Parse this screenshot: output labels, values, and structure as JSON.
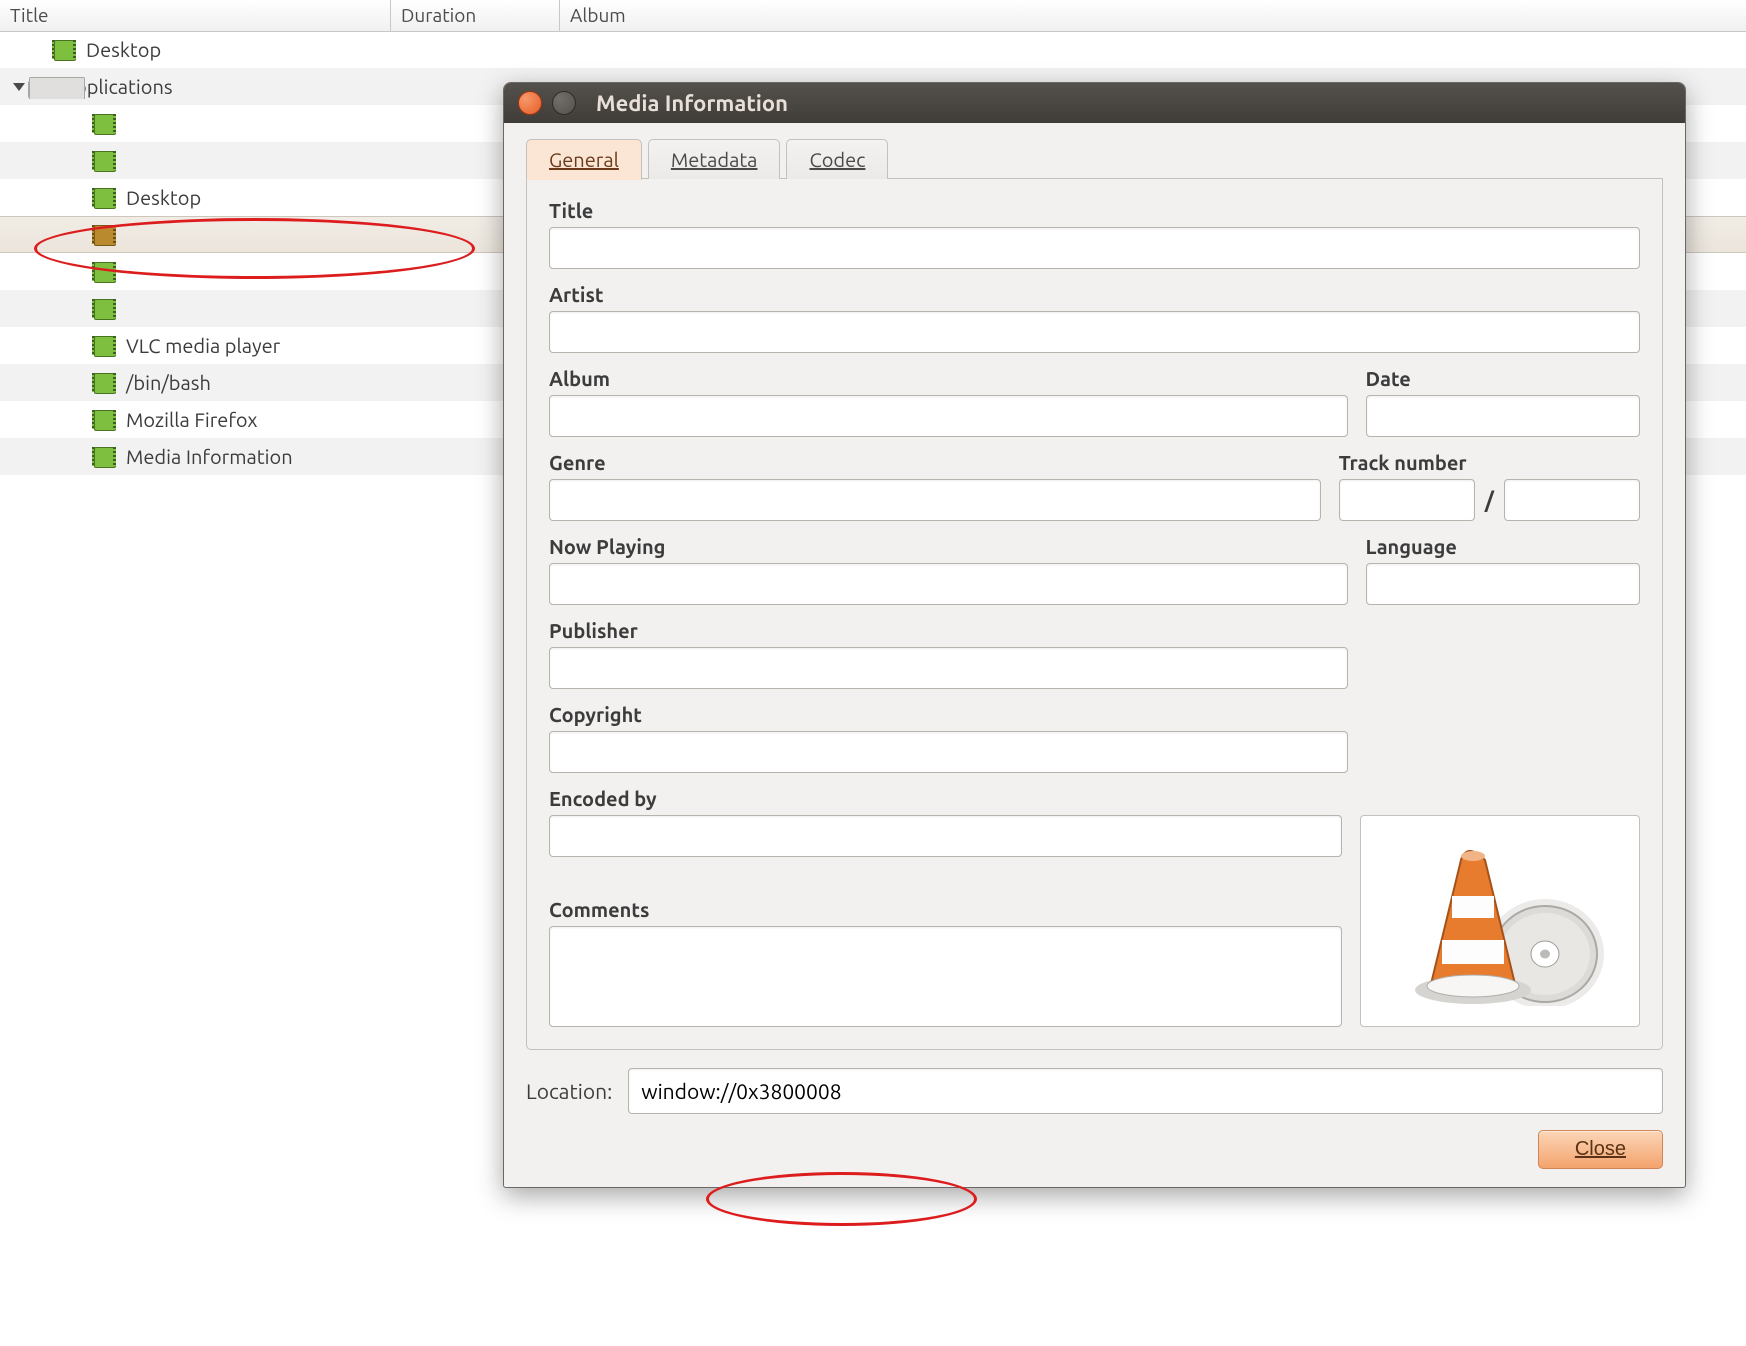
{
  "columns": {
    "title": "Title",
    "duration": "Duration",
    "album": "Album"
  },
  "playlist": {
    "items": [
      {
        "label": "Desktop",
        "icon": "film"
      },
      {
        "label": "Applications",
        "icon": "folder",
        "expanded": true
      }
    ],
    "children": [
      {
        "label": ""
      },
      {
        "label": ""
      },
      {
        "label": "Desktop"
      },
      {
        "label": ""
      },
      {
        "label": ""
      },
      {
        "label": ""
      },
      {
        "label": "VLC media player"
      },
      {
        "label": "/bin/bash"
      },
      {
        "label": "Mozilla Firefox"
      },
      {
        "label": "Media Information"
      }
    ],
    "selected_index": 3
  },
  "dialog": {
    "title": "Media Information",
    "tabs": {
      "general": "General",
      "metadata": "Metadata",
      "codec": "Codec",
      "active": "general"
    },
    "labels": {
      "title": "Title",
      "artist": "Artist",
      "album": "Album",
      "date": "Date",
      "genre": "Genre",
      "track": "Track number",
      "slash": "/",
      "now": "Now Playing",
      "lang": "Language",
      "publisher": "Publisher",
      "copyright": "Copyright",
      "encoded": "Encoded by",
      "comments": "Comments",
      "location": "Location:",
      "close": "Close"
    },
    "values": {
      "title": "",
      "artist": "",
      "album": "",
      "date": "",
      "genre": "",
      "track1": "",
      "track2": "",
      "now": "",
      "lang": "",
      "publisher": "",
      "copyright": "",
      "encoded": "",
      "comments": "",
      "location": "window://0x3800008"
    }
  }
}
